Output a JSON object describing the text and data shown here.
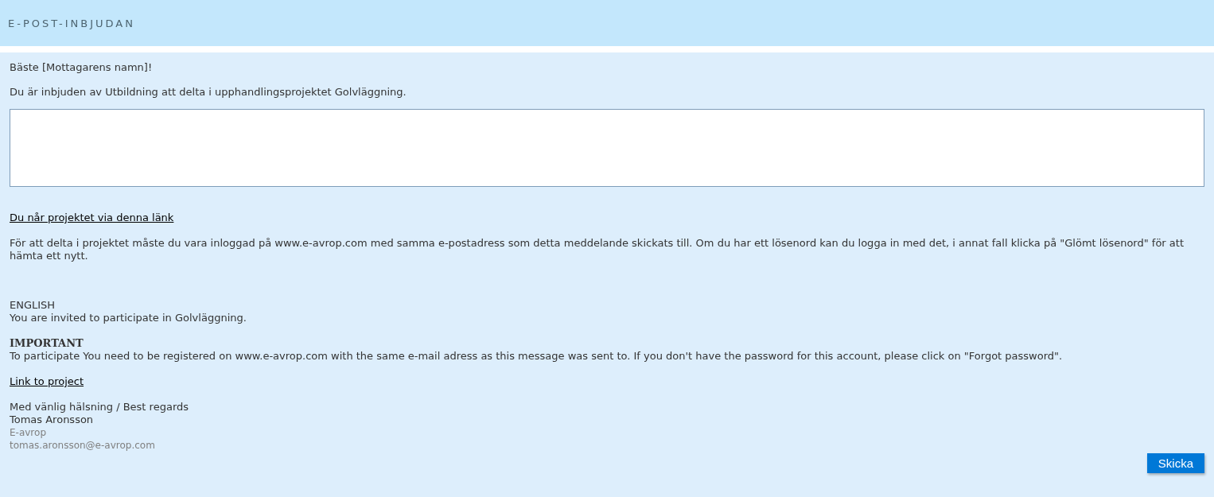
{
  "header": {
    "title": "E-POST-INBJUDAN"
  },
  "greeting": "Bäste [Mottagarens namn]!",
  "intro": "Du är inbjuden av Utbildning att delta i upphandlingsprojektet Golvläggning.",
  "project_link": "Du når projektet via denna länk",
  "instructions": "För att delta i projektet måste du vara inloggad på www.e-avrop.com med samma e-postadress som detta meddelande skickats till. Om du har ett lösenord kan du logga in med det, i annat fall klicka på \"Glömt lösenord\" för att hämta ett nytt.",
  "english": {
    "heading": "ENGLISH",
    "invite": "You are invited to participate in Golvläggning.",
    "important_heading": "IMPORTANT",
    "important_text": "To participate You need to be registered on www.e-avrop.com with the same e-mail adress as this message was sent to. If you don't have the password for this account, please click on \"Forgot password\".",
    "link": "Link to project"
  },
  "signature": {
    "closing": "Med vänlig hälsning / Best regards",
    "name": "Tomas Aronsson",
    "company": "E-avrop",
    "email": "tomas.aronsson@e-avrop.com"
  },
  "send_button": "Skicka"
}
